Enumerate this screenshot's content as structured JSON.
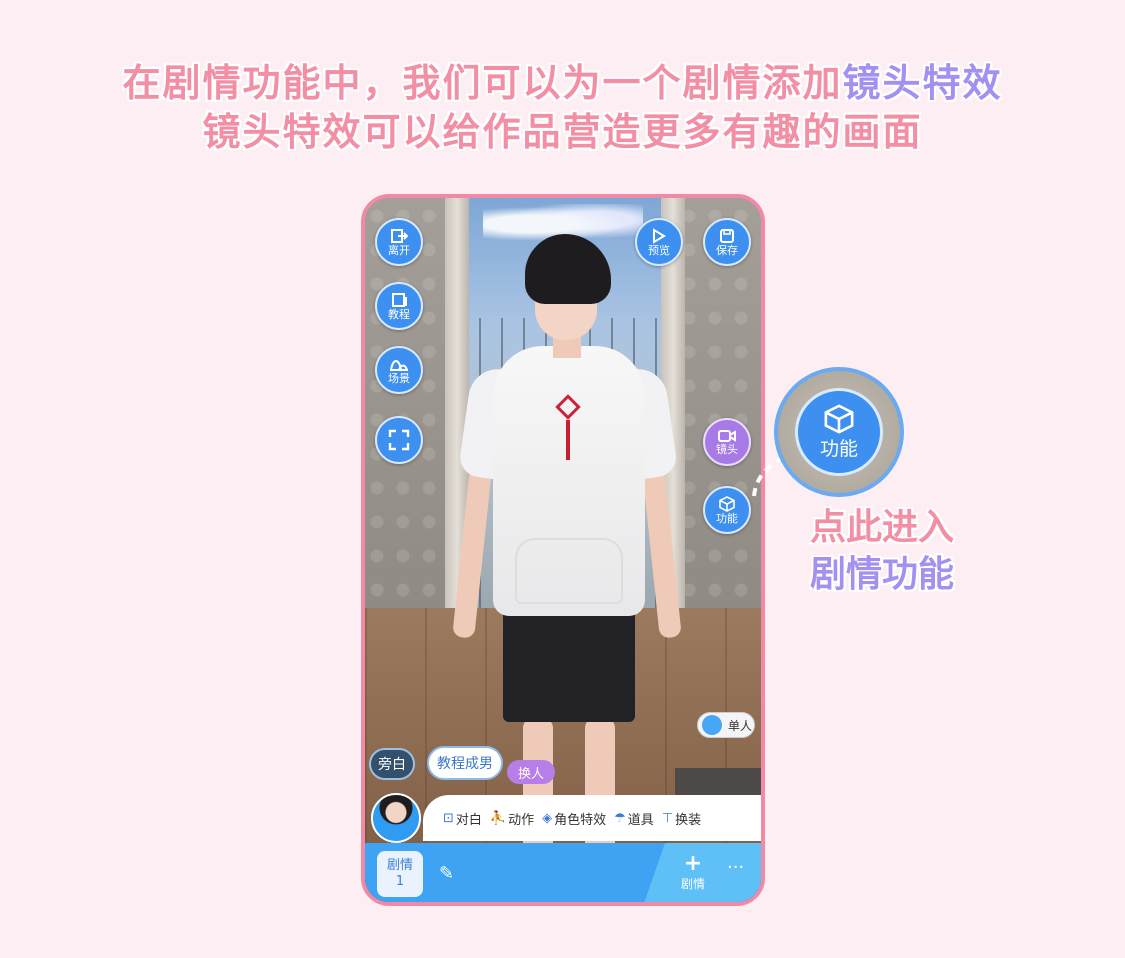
{
  "headline": {
    "line1_prefix": "在剧情功能中，我们可以为一个剧情添加",
    "line1_highlight": "镜头特效",
    "line2": "镜头特效可以给作品营造更多有趣的画面"
  },
  "phone": {
    "left_buttons": [
      "离开",
      "教程",
      "场景"
    ],
    "right_top_buttons": [
      "预览",
      "保存"
    ],
    "camera_button": "镜头",
    "function_button": "功能",
    "narration_label": "旁白",
    "character_name": "教程成男",
    "swap_label": "换人",
    "single_toggle": "单人",
    "toolbar": [
      "对白",
      "动作",
      "角色特效",
      "道具",
      "换装"
    ],
    "plot_tab": {
      "label": "剧情",
      "number": "1"
    },
    "add_plot_label": "剧情",
    "more_label": "···"
  },
  "callout": {
    "button_label": "功能",
    "hint_line1": "点此进入",
    "hint_line2": "剧情功能"
  },
  "colors": {
    "accent_pink": "#f38fa5",
    "accent_purple": "#a390f0",
    "button_blue": "#3d8ff0"
  }
}
